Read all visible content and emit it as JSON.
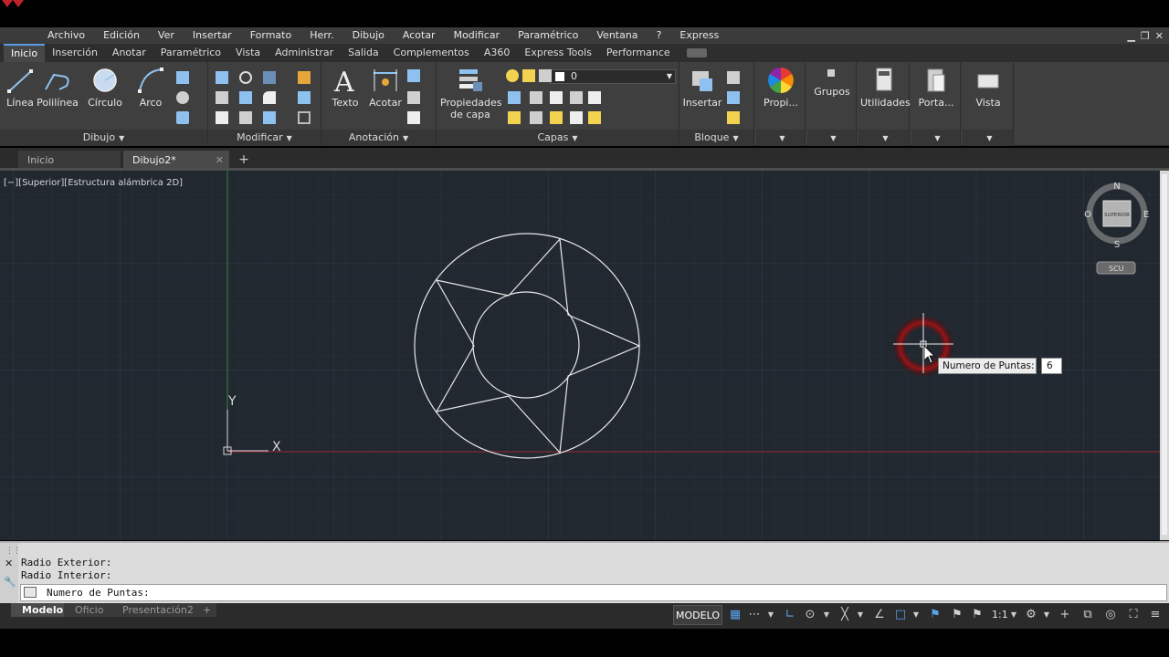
{
  "menubar": {
    "items": [
      "Archivo",
      "Edición",
      "Ver",
      "Insertar",
      "Formato",
      "Herr.",
      "Dibujo",
      "Acotar",
      "Modificar",
      "Paramétrico",
      "Ventana",
      "?",
      "Express"
    ]
  },
  "ribbon_tabs": [
    "Inicio",
    "Inserción",
    "Anotar",
    "Paramétrico",
    "Vista",
    "Administrar",
    "Salida",
    "Complementos",
    "A360",
    "Express Tools",
    "Performance"
  ],
  "ribbon": {
    "draw_tools": [
      "Línea",
      "Polilínea",
      "Círculo",
      "Arco"
    ],
    "text_tool": "Texto",
    "dim_tool": "Acotar",
    "layer_props_1": "Propiedades",
    "layer_props_2": "de capa",
    "layer_value": "0",
    "insert_tool": "Insertar",
    "props_tool": "Propi...",
    "groups_tool": "Grupos",
    "utils_tool": "Utilidades",
    "clip_tool": "Porta...",
    "view_tool": "Vista",
    "panels": {
      "dibujo": "Dibujo",
      "modificar": "Modificar",
      "anotacion": "Anotación",
      "capas": "Capas",
      "bloque": "Bloque"
    }
  },
  "file_tabs": {
    "start": "Inicio",
    "current": "Dibujo2*"
  },
  "viewport": {
    "label": "[−][Superior][Estructura alámbrica 2D]",
    "ucs_x": "X",
    "ucs_y": "Y",
    "viewcube": {
      "n": "N",
      "s": "S",
      "e": "E",
      "w": "O",
      "face": "SUPERIOR",
      "ucs": "SCU"
    }
  },
  "tooltip": {
    "label": "Numero de Puntas:",
    "value": "6"
  },
  "command": {
    "history": [
      "Radio Exterior:",
      "Radio Interior:"
    ],
    "current": "Numero de Puntas:"
  },
  "layout_tabs": [
    "Modelo",
    "Oficio",
    "Presentación2"
  ],
  "status": {
    "model": "MODELO",
    "scale": "1:1"
  },
  "colors": {
    "canvas": "#212830",
    "accent": "#59a3ee",
    "x_axis": "#9b2b34",
    "y_axis": "#2b8a3e"
  }
}
